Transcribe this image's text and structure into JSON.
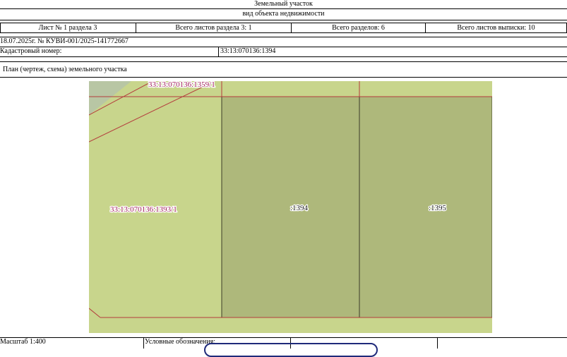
{
  "header": {
    "object_type": "Земельный участок",
    "object_type_caption": "вид объекта недвижимости"
  },
  "info_row": {
    "sheet": "Лист № 1 раздела 3",
    "total_sheets_section": "Всего листов раздела 3: 1",
    "total_sections": "Всего разделов: 6",
    "total_sheets_extract": "Всего листов выписки: 10"
  },
  "extract": {
    "date_number": "18.07.2025г. № КУВИ-001/2025-141772667",
    "cadastral_label": "Кадастровый номер:",
    "cadastral_value": "33:13:070136:1394"
  },
  "plan": {
    "title": "План (чертеж, схема) земельного участка",
    "colors": {
      "background": "#c8d58c",
      "parcel_fill": "#aeb87b",
      "corner_fill": "#b8c6a4",
      "boundary_red": "#b43c3c",
      "parcel_border": "#3c3c28",
      "label_red": "#a01e5a"
    },
    "labels": {
      "top_parcel": "33:13:070136:1359/1",
      "left_parcel": "33:13:070136:1393/1",
      "main_parcel": ":1394",
      "right_parcel": ":1395"
    }
  },
  "footer": {
    "scale": "Масштаб 1:400",
    "legend": "Условные обозначения:"
  }
}
